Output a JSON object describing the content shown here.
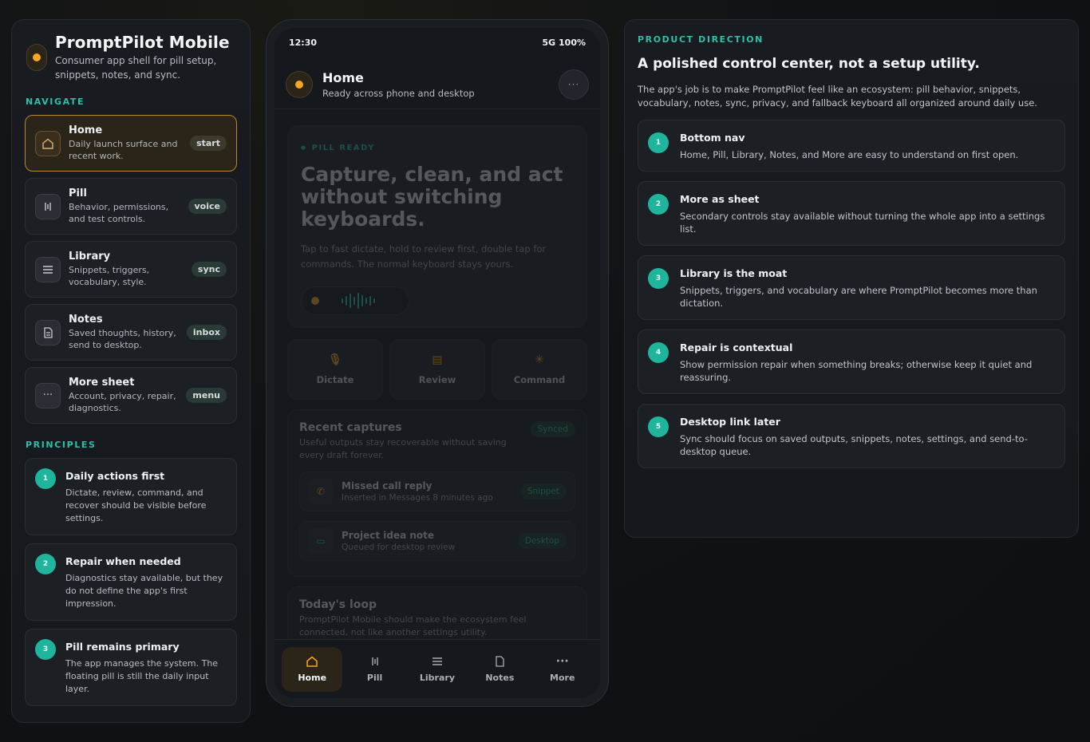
{
  "brand": {
    "title": "PromptPilot Mobile",
    "subtitle": "Consumer app shell for pill setup, snippets, notes, and sync."
  },
  "sidebar": {
    "navigate_label": "NAVIGATE",
    "items": [
      {
        "title": "Home",
        "desc": "Daily launch surface and recent work.",
        "badge": "start",
        "icon": "home-icon"
      },
      {
        "title": "Pill",
        "desc": "Behavior, permissions, and test controls.",
        "badge": "voice",
        "icon": "pill-icon"
      },
      {
        "title": "Library",
        "desc": "Snippets, triggers, vocabulary, style.",
        "badge": "sync",
        "icon": "list-icon"
      },
      {
        "title": "Notes",
        "desc": "Saved thoughts, history, send to desktop.",
        "badge": "inbox",
        "icon": "note-icon"
      },
      {
        "title": "More sheet",
        "desc": "Account, privacy, repair, diagnostics.",
        "badge": "menu",
        "icon": "more-icon"
      }
    ],
    "principles_label": "PRINCIPLES",
    "principles": [
      {
        "num": "1",
        "title": "Daily actions first",
        "desc": "Dictate, review, command, and recover should be visible before settings."
      },
      {
        "num": "2",
        "title": "Repair when needed",
        "desc": "Diagnostics stay available, but they do not define the app's first impression."
      },
      {
        "num": "3",
        "title": "Pill remains primary",
        "desc": "The app manages the system. The floating pill is still the daily input layer."
      }
    ]
  },
  "phone": {
    "time": "12:30",
    "signal": "5G 100%",
    "header": {
      "title": "Home",
      "subtitle": "Ready across phone and desktop",
      "more": "···"
    },
    "hero": {
      "tag": "PILL READY",
      "title": "Capture, clean, and act without switching keyboards.",
      "desc": "Tap to fast dictate, hold to review first, double tap for commands. The normal keyboard stays yours."
    },
    "actions": [
      {
        "label": "Dictate",
        "icon": "mic-icon"
      },
      {
        "label": "Review",
        "icon": "chat-icon"
      },
      {
        "label": "Command",
        "icon": "spark-icon"
      }
    ],
    "recent": {
      "title": "Recent captures",
      "subtitle": "Useful outputs stay recoverable without saving every draft forever.",
      "badge": "Synced",
      "items": [
        {
          "title": "Missed call reply",
          "sub": "Inserted in Messages 8 minutes ago",
          "badge": "Snippet",
          "icon": "phone-icon"
        },
        {
          "title": "Project idea note",
          "sub": "Queued for desktop review",
          "badge": "Desktop",
          "icon": "monitor-icon"
        }
      ]
    },
    "loop": {
      "title": "Today's loop",
      "desc": "PromptPilot Mobile should make the ecosystem feel connected, not like another settings utility."
    },
    "bottom_nav": [
      {
        "label": "Home",
        "icon": "home-icon"
      },
      {
        "label": "Pill",
        "icon": "pill-icon"
      },
      {
        "label": "Library",
        "icon": "list-icon"
      },
      {
        "label": "Notes",
        "icon": "note-icon"
      },
      {
        "label": "More",
        "icon": "more-icon"
      }
    ]
  },
  "panel": {
    "eyebrow": "PRODUCT DIRECTION",
    "title": "A polished control center, not a setup utility.",
    "desc": "The app's job is to make PromptPilot feel like an ecosystem: pill behavior, snippets, vocabulary, notes, sync, privacy, and fallback keyboard all organized around daily use.",
    "items": [
      {
        "num": "1",
        "title": "Bottom nav",
        "desc": "Home, Pill, Library, Notes, and More are easy to understand on first open."
      },
      {
        "num": "2",
        "title": "More as sheet",
        "desc": "Secondary controls stay available without turning the whole app into a settings list."
      },
      {
        "num": "3",
        "title": "Library is the moat",
        "desc": "Snippets, triggers, and vocabulary are where PromptPilot becomes more than dictation."
      },
      {
        "num": "4",
        "title": "Repair is contextual",
        "desc": "Show permission repair when something breaks; otherwise keep it quiet and reassuring."
      },
      {
        "num": "5",
        "title": "Desktop link later",
        "desc": "Sync should focus on saved outputs, snippets, notes, settings, and send-to-desktop queue."
      }
    ]
  },
  "colors": {
    "accent": "#f5a623",
    "teal": "#1fb59d",
    "bg": "#101216"
  }
}
